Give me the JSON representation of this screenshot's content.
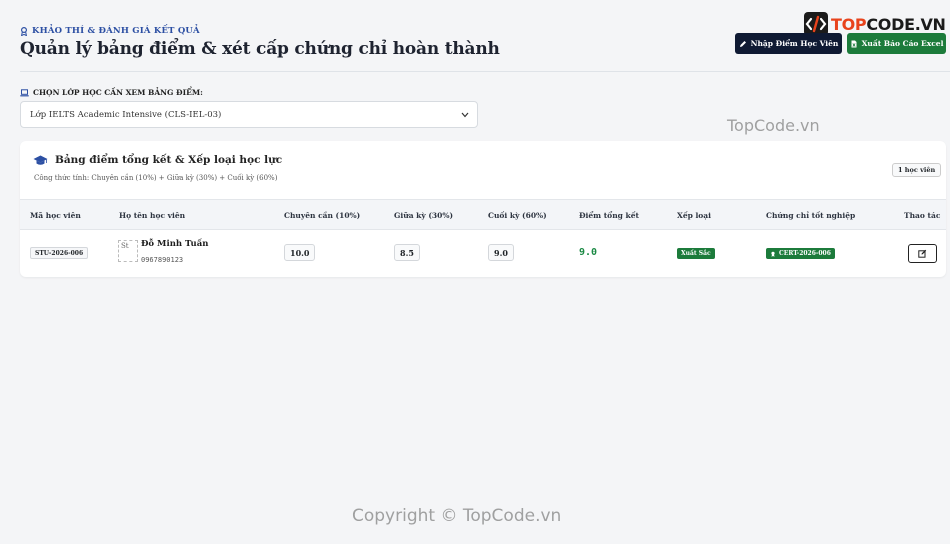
{
  "header": {
    "eyebrow": "KHẢO THÍ & ĐÁNH GIÁ KẾT QUẢ",
    "title": "Quản lý bảng điểm & xét cấp chứng chỉ hoàn thành"
  },
  "logo": {
    "prefix": "TOP",
    "suffix": "CODE.VN",
    "accent_color": "#e8431c"
  },
  "actions": {
    "import_label": "Nhập Điểm Học Viên",
    "export_label": "Xuất Báo Cáo Excel"
  },
  "class_select": {
    "label": "CHỌN LỚP HỌC CẦN XEM BẢNG ĐIỂM:",
    "selected": "Lớp IELTS Academic Intensive (CLS-IEL-03)"
  },
  "gradebook": {
    "title": "Bảng điểm tổng kết & Xếp loại học lực",
    "formula": "Công thức tính: Chuyên cần (10%) + Giữa kỳ (30%) + Cuối kỳ (60%)",
    "count": "1 học viên",
    "columns": [
      "Mã học viên",
      "Họ tên học viên",
      "Chuyên cần (10%)",
      "Giữa kỳ (30%)",
      "Cuối kỳ (60%)",
      "Điểm tổng kết",
      "Xếp loại",
      "Chứng chỉ tốt nghiệp",
      "Thao tác"
    ],
    "rows": [
      {
        "id": "STU-2026-006",
        "avatar_alt": "St",
        "name": "Đỗ Minh Tuấn",
        "phone": "0967890123",
        "attendance": "10.0",
        "midterm": "8.5",
        "final": "9.0",
        "total": "9.0",
        "rank": "Xuất Sắc",
        "certificate": "CERT-2026-006"
      }
    ]
  },
  "watermarks": {
    "top": "TopCode.vn",
    "bottom": "Copyright © TopCode.vn"
  },
  "colors": {
    "primary_dark": "#0f1a33",
    "success": "#1c7b3b",
    "eyebrow": "#2c4fa3"
  }
}
